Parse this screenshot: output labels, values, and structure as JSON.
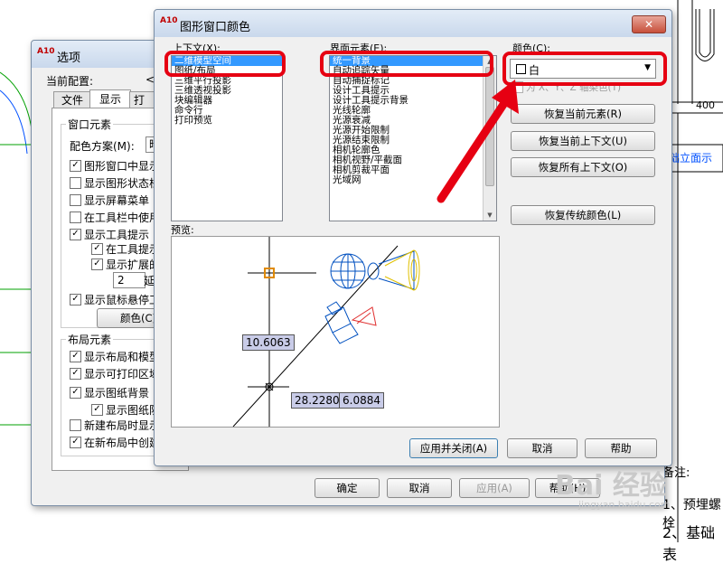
{
  "background": {
    "cad_labels": [
      "400",
      "础立面示",
      "备注:",
      "1、预埋螺栓",
      "2、基础表"
    ],
    "watermark": "Bai 经验",
    "watermark_url": "jingyan.baidu.com"
  },
  "options_dialog": {
    "title": "选项",
    "current_config_label": "当前配置:",
    "tabs": [
      "文件",
      "显示",
      "打"
    ],
    "window_elements_title": "窗口元素",
    "color_scheme_label": "配色方案(M):",
    "color_scheme_value": "暗",
    "window_checkboxes": [
      {
        "label": "图形窗口中显示",
        "checked": true
      },
      {
        "label": "显示图形状态栏",
        "checked": false
      },
      {
        "label": "显示屏幕菜单",
        "checked": false
      },
      {
        "label": "在工具栏中使用",
        "checked": false
      },
      {
        "label": "显示工具提示",
        "checked": true
      },
      {
        "label": "在工具提示",
        "checked": true
      },
      {
        "label": "显示扩展的",
        "checked": true
      }
    ],
    "delay_value": "2",
    "delay_label": "延",
    "mouse_hover_label": "显示鼠标悬停工",
    "colors_button": "颜色(C)",
    "layout_elements_title": "布局元素",
    "layout_checkboxes": [
      {
        "label": "显示布局和模型",
        "checked": true
      },
      {
        "label": "显示可打印区域",
        "checked": true
      },
      {
        "label": "显示图纸背景",
        "checked": true
      },
      {
        "label": "显示图纸阴",
        "checked": true
      },
      {
        "label": "新建布局时显示",
        "checked": false
      },
      {
        "label": "在新布局中创建",
        "checked": true
      }
    ],
    "buttons": {
      "ok": "确定",
      "cancel": "取消",
      "apply": "应用(A)",
      "help": "帮助(H)"
    }
  },
  "color_dialog": {
    "title": "图形窗口颜色",
    "close_symbol": "✕",
    "context_label": "上下文(X):",
    "contexts": [
      "二维模型空间",
      "图纸/布局",
      "三维平行投影",
      "三维透视投影",
      "块编辑器",
      "命令行",
      "打印预览"
    ],
    "selected_context": 0,
    "interface_label": "界面元素(E):",
    "elements": [
      "统一背景",
      "自动追踪矢量",
      "自动捕捉标记",
      "设计工具提示",
      "设计工具提示背景",
      "光线轮廓",
      "光源衰减",
      "光源开始限制",
      "光源结束限制",
      "相机轮廓色",
      "相机视野/平截面",
      "相机剪裁平面",
      "光域网"
    ],
    "selected_element": 0,
    "color_label": "颜色(C):",
    "color_value": "白",
    "tint_checkbox_label": "为 X、Y、Z 轴染色(T)",
    "restore_element_btn": "恢复当前元素(R)",
    "restore_context_btn": "恢复当前上下文(U)",
    "restore_all_btn": "恢复所有上下文(O)",
    "restore_classic_btn": "恢复传统颜色(L)",
    "preview_label": "预览:",
    "preview_values": [
      "10.6063",
      "28.2280",
      "6.0884"
    ],
    "apply_close_btn": "应用并关闭(A)",
    "cancel_btn": "取消",
    "help_btn": "帮助"
  },
  "colors": {
    "highlight": "#e60012",
    "selection": "#3399ff",
    "arrow": "#e60012"
  }
}
